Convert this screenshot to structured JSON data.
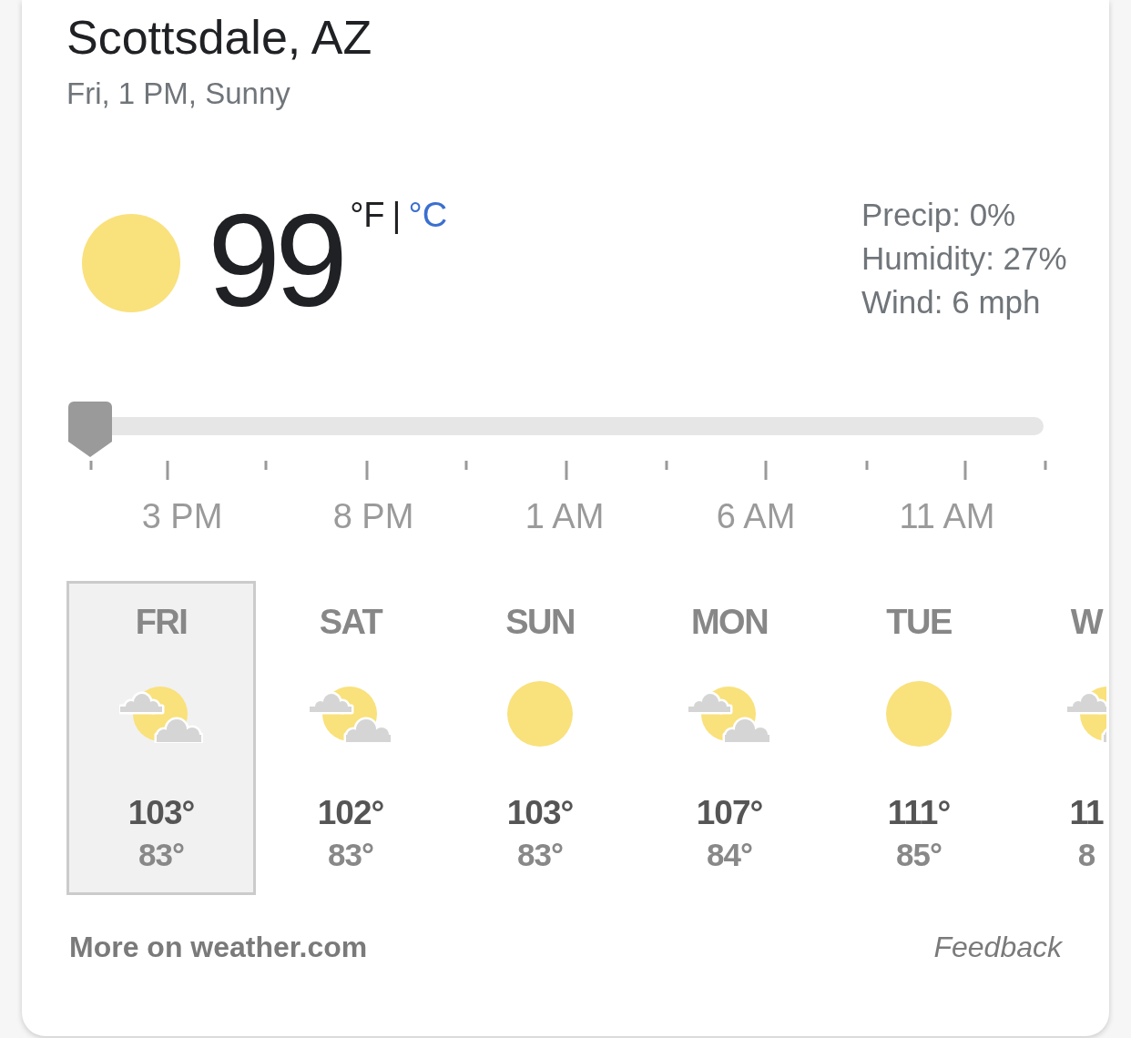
{
  "location": {
    "title": "Scottsdale, AZ",
    "subtitle": "Fri, 1 PM, Sunny"
  },
  "current": {
    "kind": "sunny",
    "temperature": "99",
    "units": [
      {
        "label": "°F",
        "selected": true
      },
      {
        "label": "°C",
        "selected": false
      }
    ],
    "separator": "|",
    "details": [
      "Precip: 0%",
      "Humidity: 27%",
      "Wind: 6 mph"
    ]
  },
  "slider": {
    "level": 0,
    "labels": [
      "3 PM",
      "8 PM",
      "1 AM",
      "6 AM",
      "11 AM"
    ]
  },
  "days": [
    {
      "label": "FRI",
      "kind": "partly_cloudy",
      "high": "103°",
      "low": "83°",
      "selected": true
    },
    {
      "label": "SAT",
      "kind": "partly_cloudy",
      "high": "102°",
      "low": "83°",
      "selected": false
    },
    {
      "label": "SUN",
      "kind": "sunny",
      "high": "103°",
      "low": "83°",
      "selected": false
    },
    {
      "label": "MON",
      "kind": "partly_cloudy",
      "high": "107°",
      "low": "84°",
      "selected": false
    },
    {
      "label": "TUE",
      "kind": "sunny",
      "high": "111°",
      "low": "85°",
      "selected": false
    },
    {
      "label": "W",
      "kind": "partly_cloudy",
      "high": "11",
      "low": "8",
      "selected": false
    }
  ],
  "footer": {
    "source_link": "More on weather.com",
    "feedback": "Feedback"
  }
}
